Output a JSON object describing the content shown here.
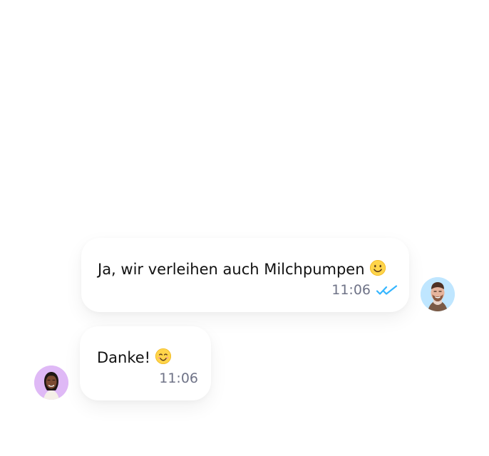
{
  "messages": [
    {
      "direction": "outgoing",
      "text": "Ja, wir verleihen auch Milchpumpen",
      "emoji": "slightly-smiling-face",
      "time": "11:06",
      "read_status": "double-check-read",
      "avatar": "man-avatar"
    },
    {
      "direction": "incoming",
      "text": "Danke!",
      "emoji": "smiling-face-with-blushing-eyes",
      "time": "11:06",
      "avatar": "woman-avatar"
    }
  ],
  "colors": {
    "read_ticks": "#35b6ff",
    "time_text": "#6f7387",
    "bubble_bg": "#ffffff"
  }
}
